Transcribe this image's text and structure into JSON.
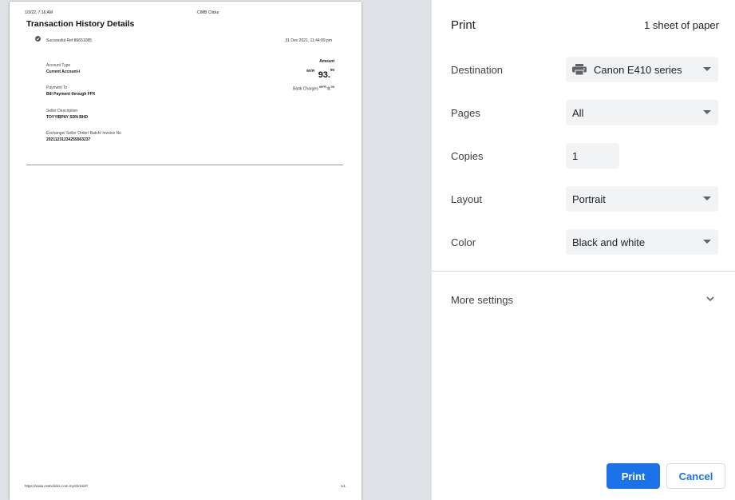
{
  "preview": {
    "header_left": "1/3/22, 7:16 AM",
    "header_center": "CIMB Clicks",
    "title": "Transaction History Details",
    "status": "Successful Ref 86651085",
    "date": "31 Dec 2021, 11:44:09 pm",
    "account_type_label": "Account Type",
    "account_type_value": "Current Account-i",
    "amount_label": "Amount",
    "amount_currency": "MYR",
    "amount_main": "93.",
    "amount_decimal": "90",
    "payment_to_label": "Payment To",
    "payment_to_value": "Bill Payment through FPX",
    "bank_charges_label": "Bank Charges",
    "bank_charges_currency": "MYR",
    "bank_charges_main": "0.",
    "bank_charges_decimal": "00",
    "seller_label": "Seller Description",
    "seller_value": "TOYYIBPAY SDN BHD",
    "exchange_label": "Exchange/ Seller Order/ Batch/ Invoice No",
    "exchange_value": "20211231234255563237",
    "footer_url": "https://www.cimbclicks.com.my/clicks/#/",
    "footer_page": "1/1"
  },
  "settings": {
    "title": "Print",
    "sheets": "1 sheet of paper",
    "destination_label": "Destination",
    "destination_value": "Canon E410 series",
    "pages_label": "Pages",
    "pages_value": "All",
    "copies_label": "Copies",
    "copies_value": "1",
    "layout_label": "Layout",
    "layout_value": "Portrait",
    "color_label": "Color",
    "color_value": "Black and white",
    "more_settings": "More settings",
    "print_button": "Print",
    "cancel_button": "Cancel"
  },
  "icons": {
    "status": "check-circle-icon",
    "printer": "printer-icon",
    "more": "chevron-down-icon"
  },
  "colors": {
    "accent": "#1a73e8",
    "preview_bg": "#dee1e6",
    "field_bg": "#f1f3f4"
  }
}
